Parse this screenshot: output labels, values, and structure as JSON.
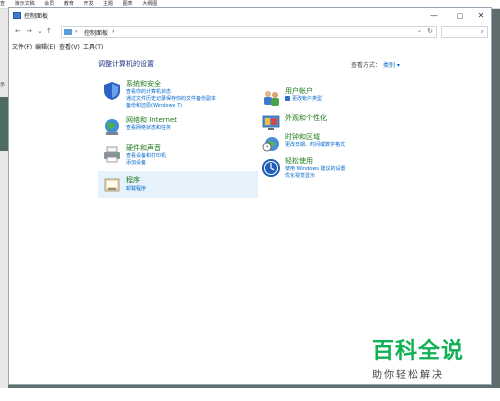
{
  "background_app": {
    "menu": [
      "查",
      "演示文稿",
      "会员",
      "教育",
      "开发",
      "主题",
      "图表",
      "大纲图"
    ],
    "left_char": "示"
  },
  "window": {
    "title": "控制面板",
    "controls": {
      "minimize": "—",
      "maximize": "□",
      "close": "✕"
    }
  },
  "address": {
    "back": "←",
    "forward": "→",
    "recent": "⌄",
    "up": "↑",
    "path": "控制面板",
    "separator": "›",
    "dropdown": "⌄",
    "refresh": "↻",
    "search_placeholder": "",
    "search_icon": "⌕"
  },
  "menubar": [
    "文件(F)",
    "编辑(E)",
    "查看(V)",
    "工具(T)"
  ],
  "main": {
    "heading": "调整计算机的设置",
    "view_by_label": "查看方式：",
    "view_by_value": "类别",
    "view_by_arrow": "▾"
  },
  "left_categories": [
    {
      "title": "系统和安全",
      "links": [
        "查看你的计算机状态",
        "通过文件历史记录保存你的文件备份副本",
        "备份和还原(Windows 7)"
      ]
    },
    {
      "title": "网络和 Internet",
      "links": [
        "查看网络状态和任务"
      ]
    },
    {
      "title": "硬件和声音",
      "links": [
        "查看设备和打印机",
        "添加设备"
      ]
    },
    {
      "title": "程序",
      "links": [
        "卸载程序"
      ]
    }
  ],
  "right_categories": [
    {
      "title": "用户帐户",
      "links": [
        "更改帐户类型"
      ]
    },
    {
      "title": "外观和个性化",
      "links": []
    },
    {
      "title": "时钟和区域",
      "links": [
        "更改日期、时间或数字格式"
      ]
    },
    {
      "title": "轻松使用",
      "links": [
        "使用 Windows 建议的设置",
        "优化视觉显示"
      ]
    }
  ],
  "watermark": {
    "big": "百科全说",
    "small": "助你轻松解决"
  },
  "colors": {
    "accent": "#1e3287",
    "category": "#1e7a1e",
    "link": "#0066cc",
    "highlight": "#e5f1fb",
    "watermark": "#10b055"
  }
}
